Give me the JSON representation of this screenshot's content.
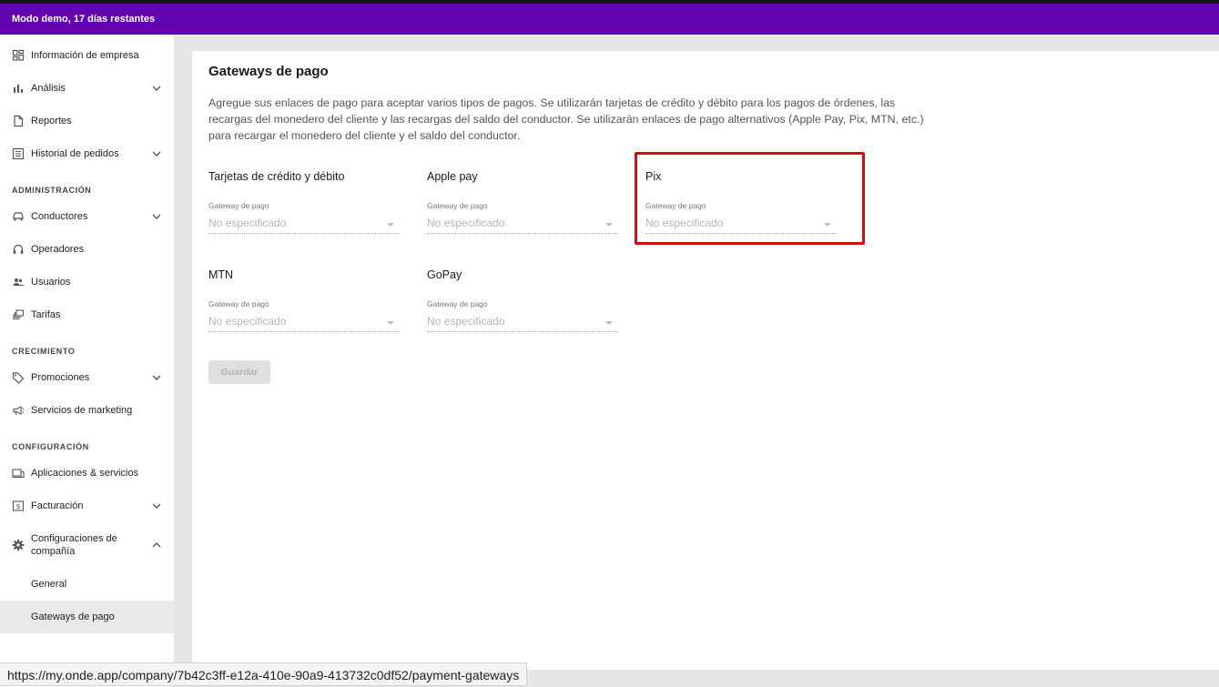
{
  "banner": {
    "text": "Modo demo, 17 días restantes"
  },
  "sidebar": {
    "items": [
      {
        "label": "Información de empresa",
        "icon": "dashboard-icon"
      },
      {
        "label": "Análisis",
        "icon": "bar-chart-icon"
      },
      {
        "label": "Reportes",
        "icon": "document-icon"
      },
      {
        "label": "Historial de pedidos",
        "icon": "list-icon"
      },
      {
        "label": "Conductores",
        "icon": "car-icon"
      },
      {
        "label": "Operadores",
        "icon": "headset-icon"
      },
      {
        "label": "Usuarios",
        "icon": "users-icon"
      },
      {
        "label": "Tarifas",
        "icon": "tariffs-icon"
      },
      {
        "label": "Promociones",
        "icon": "tag-icon"
      },
      {
        "label": "Servicios de marketing",
        "icon": "megaphone-icon"
      },
      {
        "label": "Aplicaciones & servicios",
        "icon": "devices-icon"
      },
      {
        "label": "Facturación",
        "icon": "billing-icon"
      },
      {
        "label": "Configuraciones de compañía",
        "icon": "gear-icon"
      },
      {
        "label": "General"
      },
      {
        "label": "Gateways de pago"
      }
    ],
    "sections": {
      "administracion": "ADMINISTRACIÓN",
      "crecimiento": "CRECIMIENTO",
      "configuracion": "CONFIGURACIÓN"
    }
  },
  "main": {
    "title": "Gateways de pago",
    "description": "Agregue sus enlaces de pago para aceptar varios tipos de pagos. Se utilizarán tarjetas de crédito y débito para los pagos de órdenes, las recargas del monedero del cliente y las recargas del saldo del conductor. Se utilizarán enlaces de pago alternativos (Apple Pay, Pix, MTN, etc.) para recargar el monedero del cliente y el saldo del conductor.",
    "fields": [
      {
        "label": "Tarjetas de crédito y débito",
        "caption": "Gateway de pago",
        "value": "No especificado"
      },
      {
        "label": "Apple pay",
        "caption": "Gateway de pago",
        "value": "No especificado"
      },
      {
        "label": "Pix",
        "caption": "Gateway de pago",
        "value": "No especificado"
      },
      {
        "label": "MTN",
        "caption": "Gateway de pago",
        "value": "No especificado"
      },
      {
        "label": "GoPay",
        "caption": "Gateway de pago",
        "value": "No especificado"
      }
    ],
    "save_label": "Guardar"
  },
  "status_url": "https://my.onde.app/company/7b42c3ff-e12a-410e-90a9-413732c0df52/payment-gateways",
  "colors": {
    "accent": "#6104b1",
    "highlight": "#d40d0d"
  }
}
